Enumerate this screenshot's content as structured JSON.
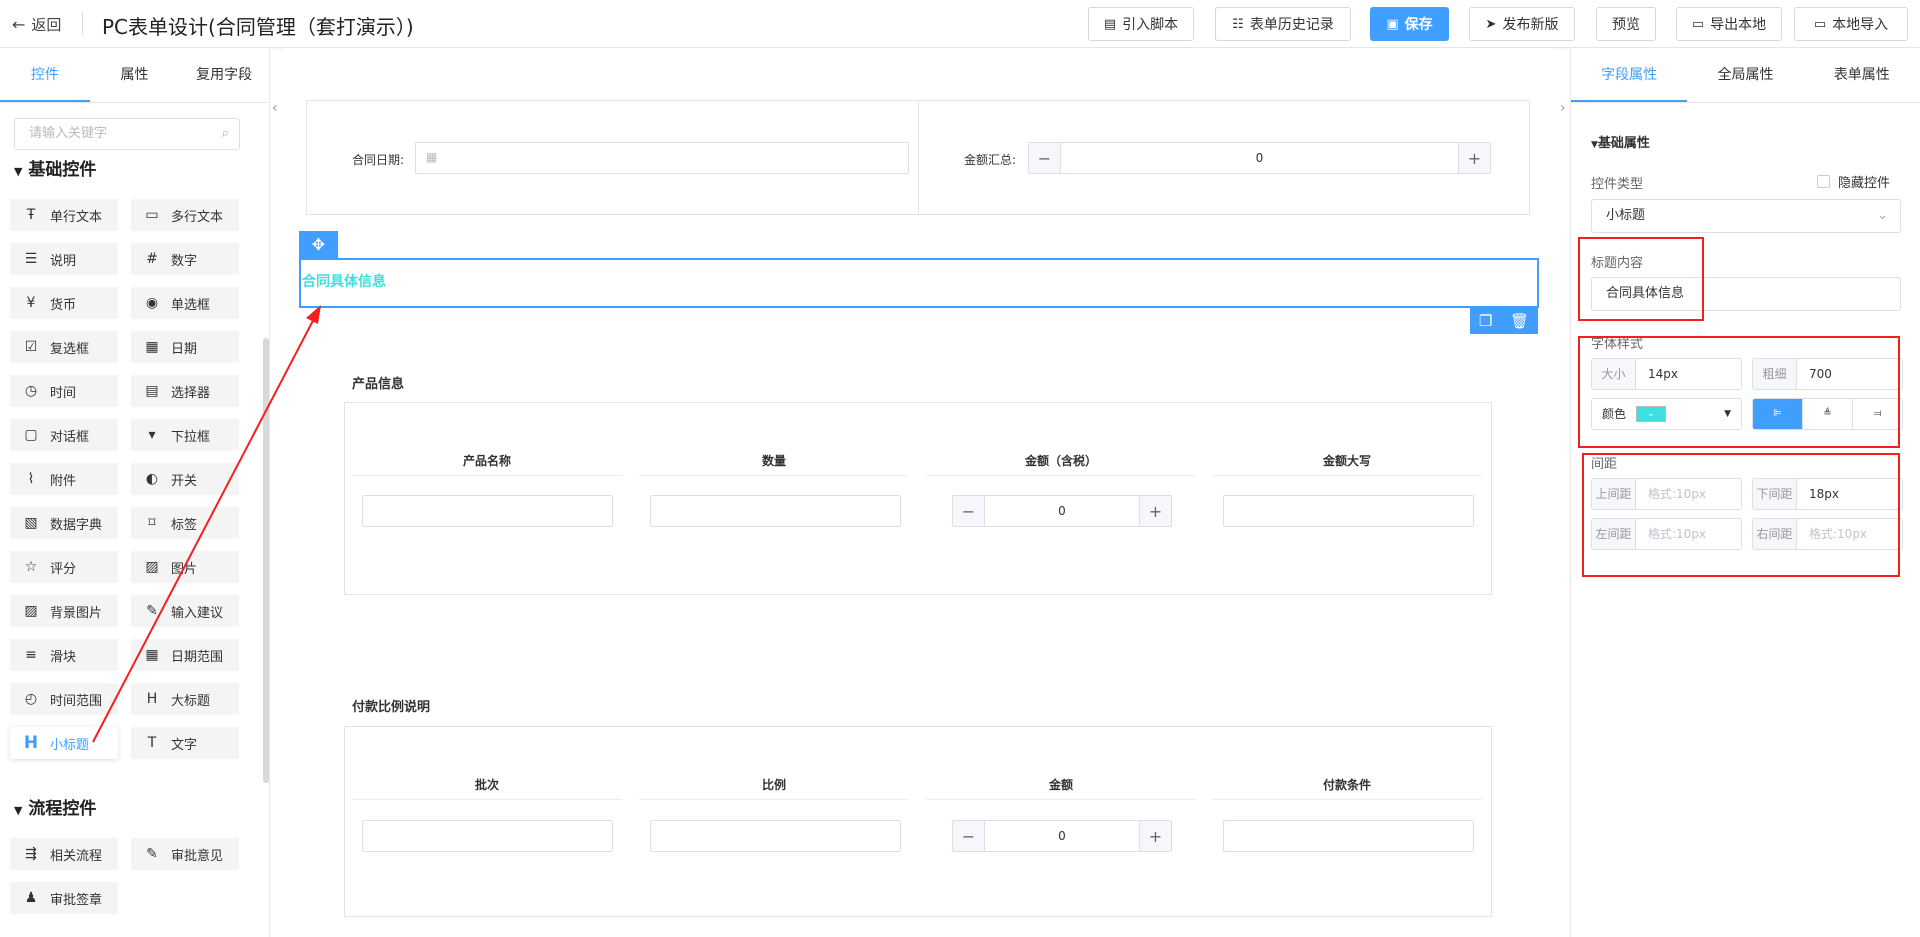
{
  "header": {
    "back_label": "返回",
    "title": "PC表单设计(合同管理（套打演示）)",
    "buttons": {
      "import_script": "引入脚本",
      "history": "表单历史记录",
      "save": "保存",
      "publish": "发布新版",
      "preview": "预览",
      "export": "导出本地",
      "import_local": "本地导入"
    }
  },
  "left": {
    "tabs": [
      "控件",
      "属性",
      "复用字段"
    ],
    "search_placeholder": "请输入关键字",
    "basic_title": "基础控件",
    "basic_controls": [
      {
        "label": "单行文本",
        "icon": "text-icon"
      },
      {
        "label": "多行文本",
        "icon": "textarea-icon"
      },
      {
        "label": "说明",
        "icon": "description-icon"
      },
      {
        "label": "数字",
        "icon": "number-icon"
      },
      {
        "label": "货币",
        "icon": "currency-icon"
      },
      {
        "label": "单选框",
        "icon": "radio-icon"
      },
      {
        "label": "复选框",
        "icon": "checkbox-icon"
      },
      {
        "label": "日期",
        "icon": "calendar-icon"
      },
      {
        "label": "时间",
        "icon": "clock-icon"
      },
      {
        "label": "选择器",
        "icon": "selector-icon"
      },
      {
        "label": "对话框",
        "icon": "dialog-icon"
      },
      {
        "label": "下拉框",
        "icon": "dropdown-icon"
      },
      {
        "label": "附件",
        "icon": "paperclip-icon"
      },
      {
        "label": "开关",
        "icon": "toggle-icon"
      },
      {
        "label": "数据字典",
        "icon": "dictionary-icon"
      },
      {
        "label": "标签",
        "icon": "tag-icon"
      },
      {
        "label": "评分",
        "icon": "star-icon"
      },
      {
        "label": "图片",
        "icon": "image-icon"
      },
      {
        "label": "背景图片",
        "icon": "background-image-icon"
      },
      {
        "label": "输入建议",
        "icon": "suggest-icon"
      },
      {
        "label": "滑块",
        "icon": "slider-icon"
      },
      {
        "label": "日期范围",
        "icon": "date-range-icon"
      },
      {
        "label": "时间范围",
        "icon": "time-range-icon"
      },
      {
        "label": "大标题",
        "icon": "heading-icon"
      },
      {
        "label": "小标题",
        "icon": "subheading-icon"
      },
      {
        "label": "文字",
        "icon": "text-box-icon"
      }
    ],
    "flow_title": "流程控件",
    "flow_controls": [
      {
        "label": "相关流程",
        "icon": "flow-icon"
      },
      {
        "label": "审批意见",
        "icon": "approve-icon"
      },
      {
        "label": "审批签章",
        "icon": "stamp-icon"
      }
    ]
  },
  "canvas": {
    "contract_date_label": "合同日期:",
    "amount_total_label": "金额汇总:",
    "amount_total_value": "0",
    "section_title": "合同具体信息",
    "product": {
      "title": "产品信息",
      "headers": [
        "产品名称",
        "数量",
        "金额（含税）",
        "金额大写"
      ],
      "amount_value": "0"
    },
    "payment": {
      "title": "付款比例说明",
      "headers": [
        "批次",
        "比例",
        "金额",
        "付款条件"
      ],
      "amount_value": "0"
    }
  },
  "right": {
    "tabs": [
      "字段属性",
      "全局属性",
      "表单属性"
    ],
    "basic_props_title": "基础属性",
    "control_type_label": "控件类型",
    "hide_control_label": "隐藏控件",
    "control_type_value": "小标题",
    "title_content_label": "标题内容",
    "title_content_value": "合同具体信息",
    "font_style_label": "字体样式",
    "size_label": "大小",
    "size_value": "14px",
    "weight_label": "粗细",
    "weight_value": "700",
    "color_label": "颜色",
    "color_value": "#3de0e0",
    "spacing_label": "间距",
    "top_label": "上间距",
    "top_placeholder": "格式:10px",
    "bottom_label": "下间距",
    "bottom_value": "18px",
    "left_label": "左间距",
    "left_placeholder": "格式:10px",
    "right_label": "右间距",
    "right_placeholder": "格式:10px"
  },
  "colors": {
    "accent": "#409eff",
    "annotation": "#f51f1f",
    "heading": "#3de0e0"
  }
}
